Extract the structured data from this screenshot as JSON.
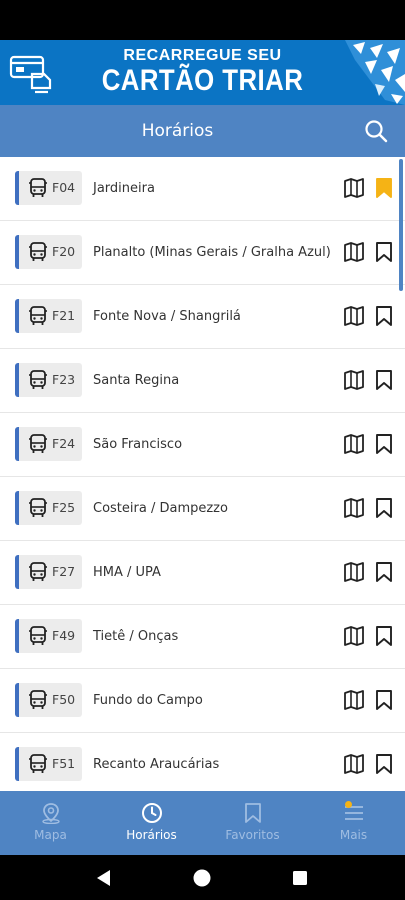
{
  "banner": {
    "line1": "RECARREGUE SEU",
    "line2": "CARTÃO TRIAR"
  },
  "appbar": {
    "title": "Horários",
    "search_icon": "search-icon"
  },
  "routes": [
    {
      "code": "F04",
      "name": "Jardineira",
      "favorite": true
    },
    {
      "code": "F20",
      "name": "Planalto (Minas Gerais / Gralha Azul)",
      "favorite": false
    },
    {
      "code": "F21",
      "name": "Fonte Nova / Shangrilá",
      "favorite": false
    },
    {
      "code": "F23",
      "name": "Santa Regina",
      "favorite": false
    },
    {
      "code": "F24",
      "name": "São Francisco",
      "favorite": false
    },
    {
      "code": "F25",
      "name": "Costeira / Dampezzo",
      "favorite": false
    },
    {
      "code": "F27",
      "name": "HMA / UPA",
      "favorite": false
    },
    {
      "code": "F49",
      "name": "Tietê / Onças",
      "favorite": false
    },
    {
      "code": "F50",
      "name": "Fundo do Campo",
      "favorite": false
    },
    {
      "code": "F51",
      "name": "Recanto Araucárias",
      "favorite": false
    }
  ],
  "bottom_nav": [
    {
      "label": "Mapa",
      "icon": "map-pin-icon",
      "active": false
    },
    {
      "label": "Horários",
      "icon": "clock-icon",
      "active": true
    },
    {
      "label": "Favoritos",
      "icon": "bookmark-icon",
      "active": false
    },
    {
      "label": "Mais",
      "icon": "menu-icon",
      "active": false,
      "notification": true
    }
  ],
  "colors": {
    "banner": "#0b74c4",
    "appbar": "#4f84c3",
    "badge_accent": "#3f6fc0",
    "favorite": "#f5b315",
    "nav_inactive": "#9fbde2"
  }
}
